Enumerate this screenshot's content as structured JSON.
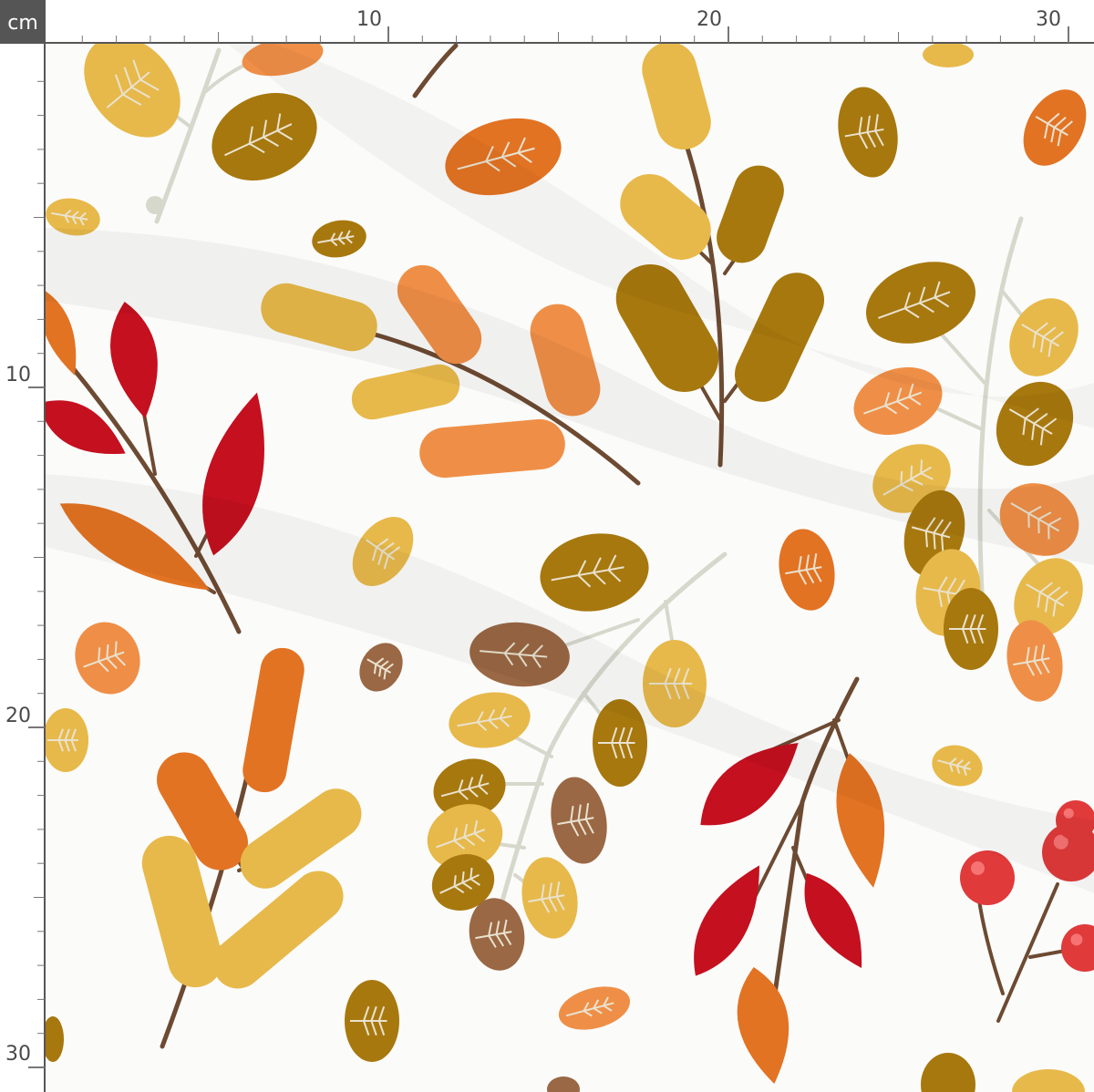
{
  "ruler": {
    "unit": "cm",
    "top_labels": [
      "10",
      "20",
      "30"
    ],
    "left_labels": [
      "10",
      "20",
      "30"
    ],
    "unit_box_color": "#555555",
    "ruler_line_color": "#555555"
  },
  "pattern": {
    "background_color": "#fbfbfa",
    "palette": {
      "mustard": "#e7b94a",
      "olive": "#a7780e",
      "orange": "#e27323",
      "peach": "#ef8f47",
      "red": "#c4101f",
      "brown": "#9a6844",
      "stem_brown": "#6d4a32",
      "stem_grey": "#d7d8cc",
      "berry_red": "#e03a3a"
    }
  }
}
